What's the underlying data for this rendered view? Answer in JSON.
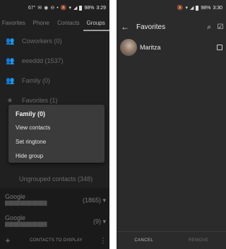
{
  "left": {
    "status_bar": {
      "time": "3:29",
      "battery": "98%",
      "notif": "67°"
    },
    "tabs": [
      {
        "label": "Favorites"
      },
      {
        "label": "Phone"
      },
      {
        "label": "Contacts"
      },
      {
        "label": "Groups"
      }
    ],
    "groups": [
      {
        "label": "Coworkers (0)",
        "icon": "group-icon"
      },
      {
        "label": "eeeddd (1537)",
        "icon": "group-icon"
      },
      {
        "label": "Family (0)",
        "icon": "group-icon"
      },
      {
        "label": "Favorites (1)",
        "icon": "star-icon"
      }
    ],
    "context_menu": {
      "title": "Family (0)",
      "items": [
        "View contacts",
        "Set ringtone",
        "Hide group"
      ]
    },
    "ungrouped": "Ungrouped contacts (348)",
    "accounts": [
      {
        "name": "Google",
        "count": "(1865)"
      },
      {
        "name": "Google",
        "count": "(9)"
      }
    ],
    "bottom_bar": {
      "label": "CONTACTS TO DISPLAY"
    }
  },
  "right": {
    "status_bar": {
      "time": "3:30",
      "battery": "98%"
    },
    "toolbar": {
      "title": "Favorites"
    },
    "contacts": [
      {
        "name": "Maritza"
      }
    ],
    "bottom_bar": {
      "cancel": "CANCEL",
      "remove": "REMOVE"
    }
  }
}
